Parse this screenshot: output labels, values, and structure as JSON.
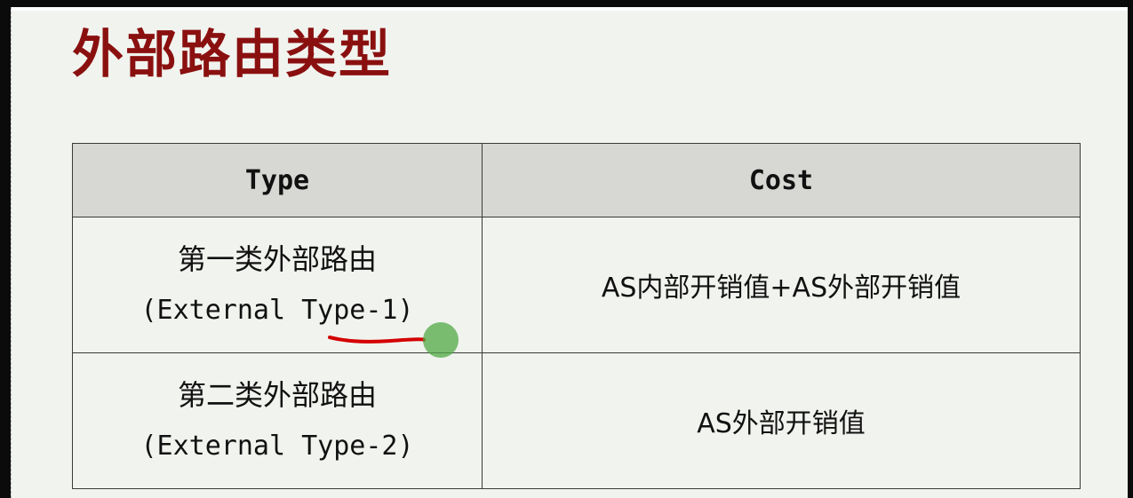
{
  "slide": {
    "title": "外部路由类型"
  },
  "table": {
    "headers": [
      "Type",
      "Cost"
    ],
    "rows": [
      {
        "type_cn": "第一类外部路由",
        "type_en": "(External Type-1)",
        "cost": "AS内部开销值+AS外部开销值"
      },
      {
        "type_cn": "第二类外部路由",
        "type_en": "(External Type-2)",
        "cost": "AS外部开销值"
      }
    ]
  },
  "annotation": {
    "underline_color": "#d40000",
    "pointer_color": "#52aa46"
  },
  "colors": {
    "title": "#8a1010",
    "slide_background": "#f1f3ee",
    "header_background": "#d7d7d4"
  }
}
